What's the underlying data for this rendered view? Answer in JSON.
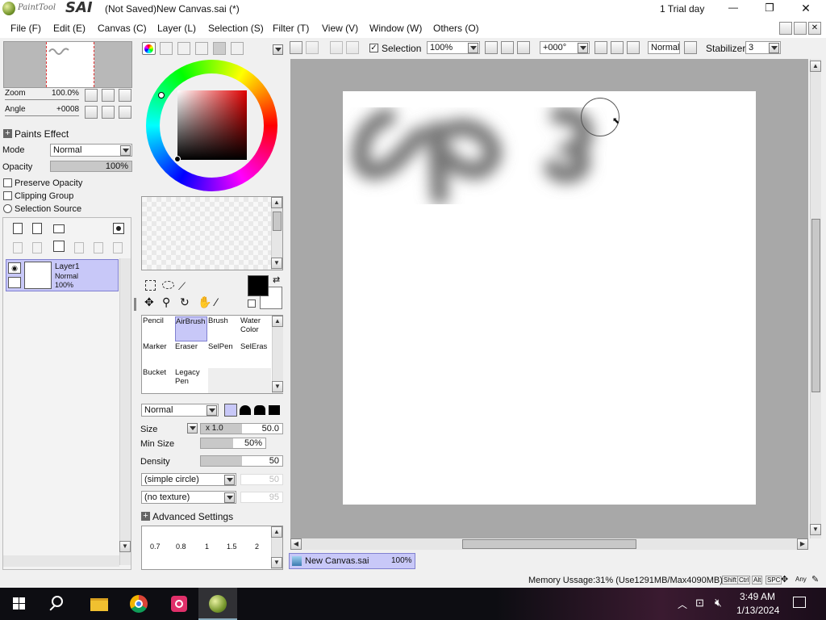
{
  "window": {
    "app_logo": "PaintTool SAI",
    "app_logo_small": "PaintTool",
    "app_logo_big": "SAI",
    "title": "(Not Saved)New Canvas.sai (*)",
    "trial": "1 Trial day",
    "min_glyph": "—",
    "max_glyph": "❐",
    "close_glyph": "✕"
  },
  "menu": [
    "File (F)",
    "Edit (E)",
    "Canvas (C)",
    "Layer (L)",
    "Selection (S)",
    "Filter (T)",
    "View (V)",
    "Window (W)",
    "Others (O)"
  ],
  "navigator": {
    "zoom_label": "Zoom",
    "zoom_value": "100.0%",
    "angle_label": "Angle",
    "angle_value": "+0008"
  },
  "layer_props": {
    "paints_effect": "Paints Effect",
    "mode_label": "Mode",
    "mode_value": "Normal",
    "opacity_label": "Opacity",
    "opacity_value": "100%",
    "opacity_level": 1.0,
    "preserve_opacity": "Preserve Opacity",
    "clipping_group": "Clipping Group",
    "selection_source": "Selection Source"
  },
  "layers": [
    {
      "name": "Layer1",
      "mode": "Normal",
      "opacity": "100%"
    }
  ],
  "toolbar": {
    "selection_label": "Selection",
    "zoom": "100%",
    "angle": "+000°",
    "blend": "Normal",
    "stabilizer_label": "Stabilizer",
    "stabilizer_value": "3"
  },
  "tools": [
    {
      "label1": "Pencil",
      "label2": ""
    },
    {
      "label1": "AirBrush",
      "label2": ""
    },
    {
      "label1": "Brush",
      "label2": ""
    },
    {
      "label1": "Water",
      "label2": "Color"
    },
    {
      "label1": "Marker",
      "label2": ""
    },
    {
      "label1": "Eraser",
      "label2": ""
    },
    {
      "label1": "SelPen",
      "label2": ""
    },
    {
      "label1": "SelEras",
      "label2": ""
    },
    {
      "label1": "Bucket",
      "label2": ""
    },
    {
      "label1": "Legacy",
      "label2": "Pen"
    }
  ],
  "brush": {
    "blend_mode": "Normal",
    "size_label": "Size",
    "size_mult": "x 1.0",
    "size_value": "50.0",
    "size_level": 0.5,
    "min_size_label": "Min Size",
    "min_size_value": "50%",
    "min_size_level": 0.5,
    "density_label": "Density",
    "density_value": "50",
    "density_level": 0.5,
    "shape": "(simple circle)",
    "shape_value": "50",
    "texture": "(no texture)",
    "texture_value": "95",
    "advanced_settings": "Advanced Settings",
    "preset_sizes": [
      "0.7",
      "0.8",
      "1",
      "1.5",
      "2"
    ]
  },
  "document_tab": {
    "name": "New Canvas.sai",
    "zoom": "100%"
  },
  "status": {
    "memory": "Memory Ussage:31% (Use1291MB/Max4090MB)",
    "keys": [
      "Shift",
      "Ctrl",
      "Alt",
      "SPC",
      "Any"
    ]
  },
  "taskbar": {
    "time": "3:49 AM",
    "date": "1/13/2024",
    "apps": [
      "start",
      "search",
      "file-explorer",
      "chrome",
      "app",
      "paint-tool-sai"
    ]
  },
  "colors": {
    "accent": "#c8c8f8",
    "canvas_bg": "#a8a8a8",
    "foreground": "#000000",
    "background": "#ffffff"
  }
}
